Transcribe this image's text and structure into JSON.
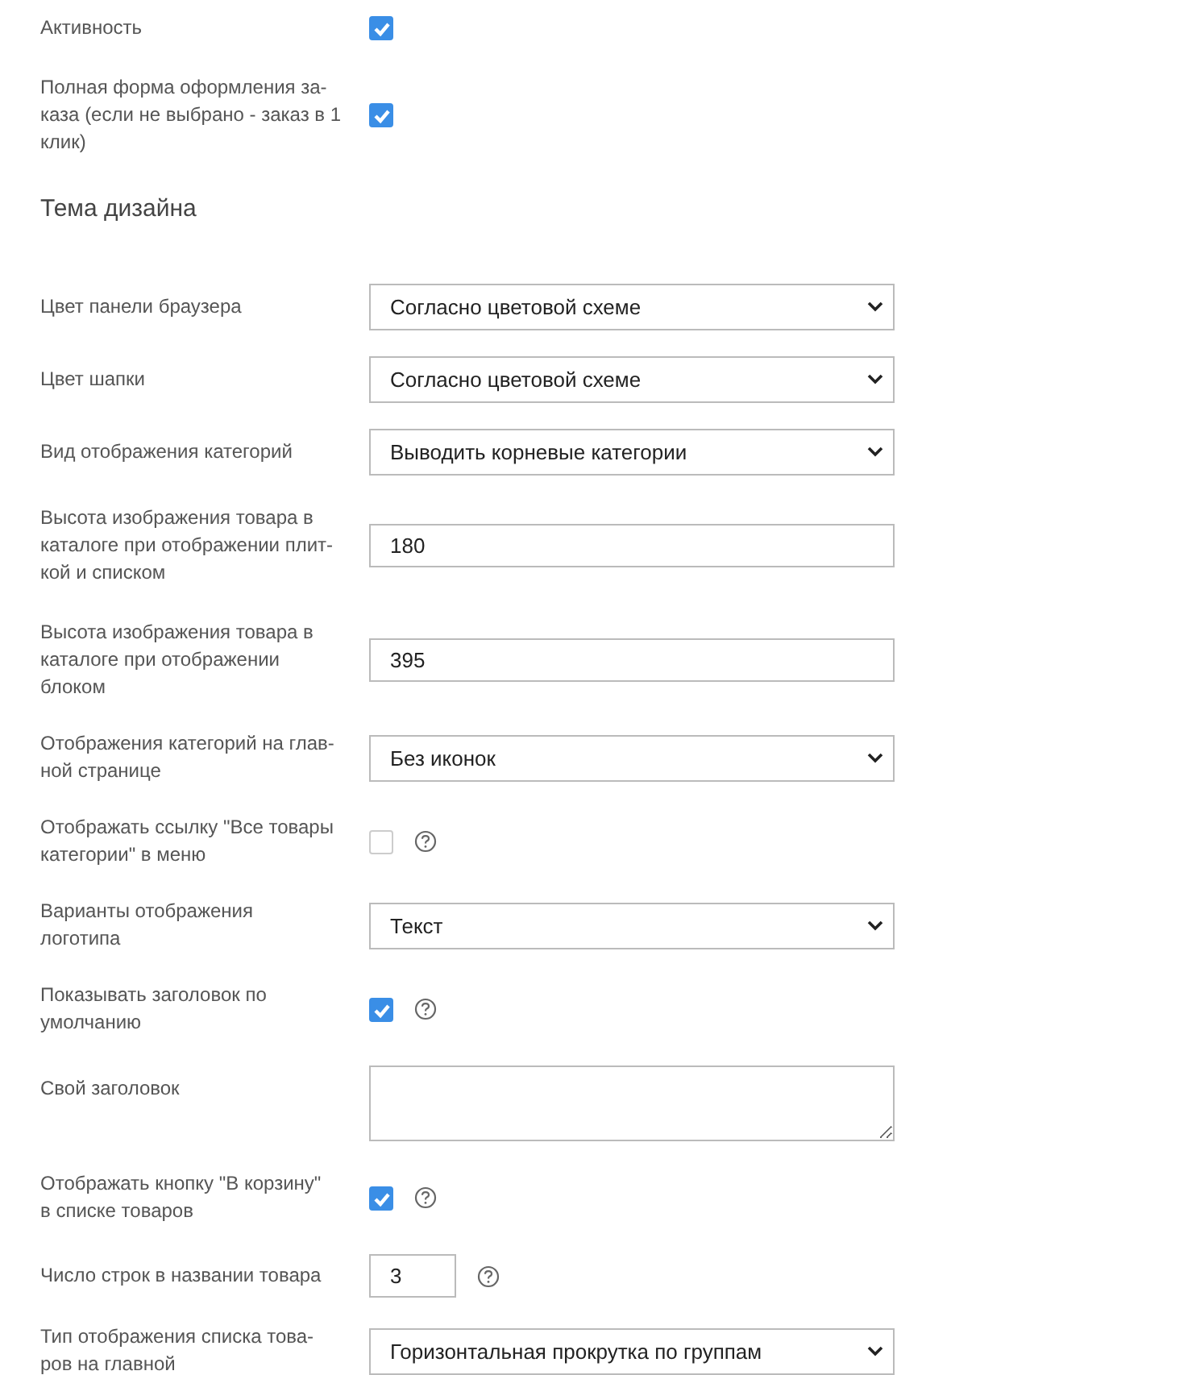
{
  "fields_top": [
    {
      "kind": "checkbox",
      "label": [
        "Активность"
      ],
      "checked": true,
      "help": false
    },
    {
      "kind": "checkbox",
      "label": [
        "Полная форма оформления за-",
        "каза (если не выбрано - заказ в 1",
        "клик)"
      ],
      "checked": true,
      "help": false
    }
  ],
  "section_title": "Тема дизайна",
  "fields": [
    {
      "kind": "select",
      "label": [
        "Цвет панели браузера"
      ],
      "value": "Согласно цветовой схеме",
      "help": false
    },
    {
      "kind": "select",
      "label": [
        "Цвет шапки"
      ],
      "value": "Согласно цветовой схеме",
      "help": false
    },
    {
      "kind": "select",
      "label": [
        "Вид отображения категорий"
      ],
      "value": "Выводить корневые категории",
      "help": false
    },
    {
      "kind": "input",
      "label": [
        "Высота изображения товара в",
        "каталоге при отображении плит-",
        "кой и списком"
      ],
      "value": "180",
      "help": false
    },
    {
      "kind": "input",
      "label": [
        "Высота изображения товара в",
        "каталоге при отображении",
        "блоком"
      ],
      "value": "395",
      "help": false
    },
    {
      "kind": "select",
      "label": [
        "Отображения категорий на глав-",
        "ной странице"
      ],
      "value": "Без иконок",
      "help": false
    },
    {
      "kind": "checkbox",
      "label": [
        "Отображать ссылку \"Все товары",
        "категории\" в меню"
      ],
      "checked": false,
      "help": true
    },
    {
      "kind": "select",
      "label": [
        "Варианты отображения",
        "логотипа"
      ],
      "value": "Текст",
      "help": false
    },
    {
      "kind": "checkbox",
      "label": [
        "Показывать заголовок по",
        "умолчанию"
      ],
      "checked": true,
      "help": true
    },
    {
      "kind": "textarea",
      "label": [
        "Свой заголовок"
      ],
      "help": false
    },
    {
      "kind": "checkbox",
      "label": [
        "Отображать кнопку \"В корзину\"",
        "в списке товаров"
      ],
      "checked": true,
      "help": true
    },
    {
      "kind": "number",
      "label": [
        "Число строк в названии товара"
      ],
      "value": "3",
      "help": true
    },
    {
      "kind": "select",
      "label": [
        "Тип отображения списка това-",
        "ров на главной"
      ],
      "value": "Горизонтальная прокрутка по группам",
      "help": false
    }
  ]
}
